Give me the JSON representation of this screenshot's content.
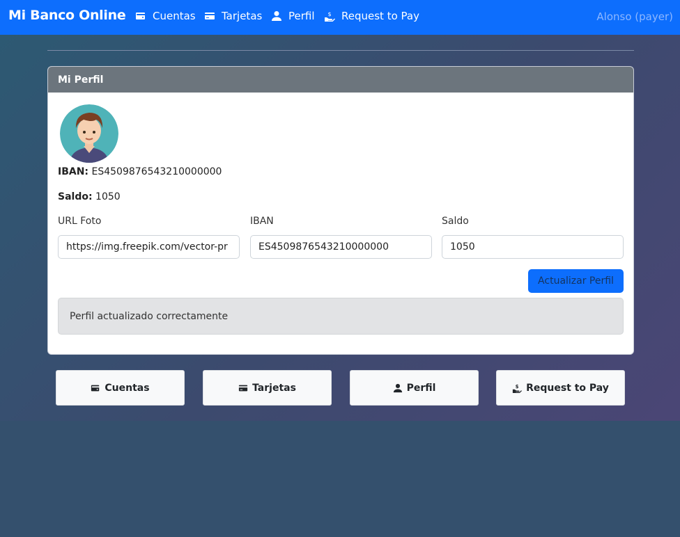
{
  "navbar": {
    "brand": "Mi Banco Online",
    "items": [
      {
        "label": "Cuentas",
        "icon": "wallet-icon"
      },
      {
        "label": "Tarjetas",
        "icon": "credit-card-icon"
      },
      {
        "label": "Perfil",
        "icon": "user-icon"
      },
      {
        "label": "Request to Pay",
        "icon": "hand-dollar-icon"
      }
    ],
    "user": "Alonso (payer)"
  },
  "profile_card": {
    "header": "Mi Perfil",
    "avatar_icon": "avatar-illustration",
    "iban_label": "IBAN:",
    "iban_value": "ES4509876543210000000",
    "saldo_label": "Saldo:",
    "saldo_value": "1050"
  },
  "form": {
    "url_label": "URL Foto",
    "url_value": "https://img.freepik.com/vector-pr",
    "iban_label": "IBAN",
    "iban_value": "ES4509876543210000000",
    "saldo_label": "Saldo",
    "saldo_value": "1050",
    "submit_label": "Actualizar Perfil"
  },
  "alert": {
    "message": "Perfil actualizado correctamente"
  },
  "quick_links": [
    {
      "label": "Cuentas",
      "icon": "wallet-icon"
    },
    {
      "label": "Tarjetas",
      "icon": "credit-card-icon"
    },
    {
      "label": "Perfil",
      "icon": "user-icon"
    },
    {
      "label": "Request to Pay",
      "icon": "hand-dollar-icon"
    }
  ],
  "colors": {
    "primary": "#0d6efd",
    "card_header": "#6c757d",
    "alert_bg": "#e2e3e5"
  }
}
